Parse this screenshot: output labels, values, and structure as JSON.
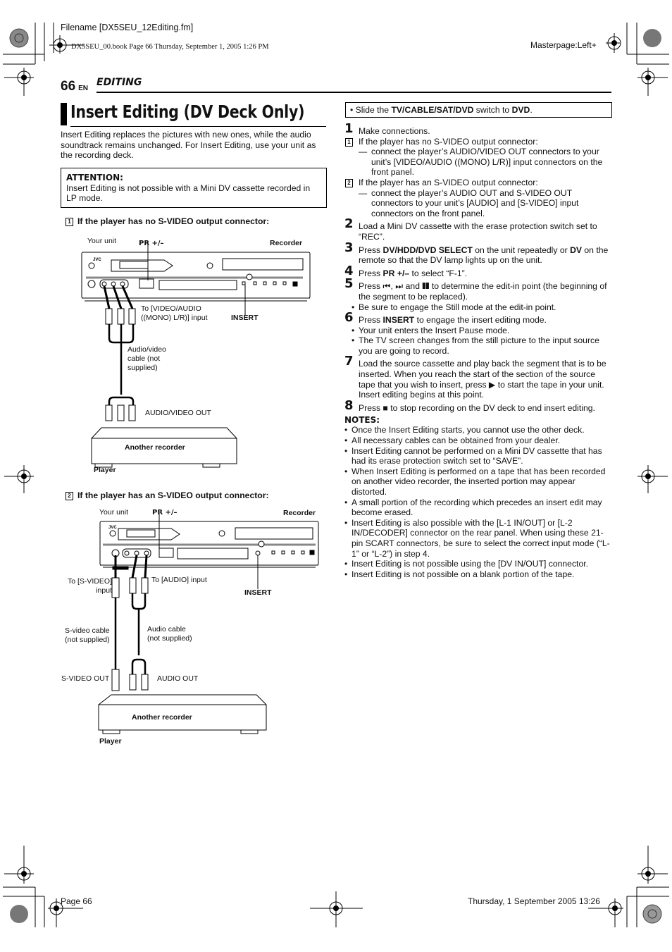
{
  "header": {
    "filename": "Filename [DX5SEU_12Editing.fm]",
    "book_line": "DX5SEU_00.book  Page 66  Thursday, September 1, 2005  1:26 PM",
    "masterpage": "Masterpage:Left+",
    "page_number": "66",
    "lang": "EN",
    "section": "EDITING"
  },
  "title": "Insert Editing (DV Deck Only)",
  "intro": "Insert Editing replaces the pictures with new ones, while the audio soundtrack remains unchanged. For Insert Editing, use your unit as the recording deck.",
  "attention": {
    "heading": "ATTENTION:",
    "text": "Insert Editing is not possible with a Mini DV cassette recorded in LP mode."
  },
  "diagram1": {
    "number": "1",
    "heading": "If the player has no S-VIDEO output connector:",
    "your_unit": "Your unit",
    "pr": "PR +/–",
    "recorder": "Recorder",
    "jvc": "JVC",
    "to_input": "To [VIDEO/AUDIO ((MONO) L/R)] input",
    "insert": "INSERT",
    "cable": "Audio/video cable (not supplied)",
    "out": "AUDIO/VIDEO OUT",
    "another": "Another recorder",
    "player": "Player"
  },
  "diagram2": {
    "number": "2",
    "heading": "If the player has an S-VIDEO output connector:",
    "your_unit": "Your unit",
    "pr": "PR +/–",
    "recorder": "Recorder",
    "jvc": "JVC",
    "to_svideo": "To [S-VIDEO] input",
    "to_audio": "To [AUDIO] input",
    "insert": "INSERT",
    "svideo_cable": "S-video cable (not supplied)",
    "audio_cable": "Audio cable (not supplied)",
    "svideo_out": "S-VIDEO OUT",
    "audio_out": "AUDIO OUT",
    "another": "Another recorder",
    "player": "Player"
  },
  "right": {
    "slide_prefix": "Slide the ",
    "slide_bold1": "TV/CABLE/SAT/DVD",
    "slide_mid": " switch to ",
    "slide_bold2": "DVD",
    "slide_end": ".",
    "steps": [
      {
        "n": "1",
        "text": "Make connections."
      },
      {
        "n": "2",
        "text": "Load a Mini DV cassette with the erase protection switch set to “REC”."
      },
      {
        "n": "3",
        "pre": "Press ",
        "b1": "DV/HDD/DVD SELECT",
        "mid": " on the unit repeatedly or ",
        "b2": "DV",
        "post": " on the remote so that the DV lamp lights up on the unit."
      },
      {
        "n": "4",
        "pre": "Press ",
        "b1": "PR +/–",
        "post": " to select “F-1”."
      },
      {
        "n": "5",
        "text": "Press ⏮, ⏭ and ❚❚ to determine the edit-in point (the beginning of the segment to be replaced).",
        "bullet": "Be sure to engage the Still mode at the edit-in point."
      },
      {
        "n": "6",
        "pre": "Press ",
        "b1": "INSERT",
        "post": " to engage the insert editing mode.",
        "bullets": [
          "Your unit enters the Insert Pause mode.",
          "The TV screen changes from the still picture to the input source you are going to record."
        ]
      },
      {
        "n": "7",
        "text": "Load the source cassette and play back the segment that is to be inserted. When you reach the start of the section of the source tape that you wish to insert, press ▶ to start the tape in your unit. Insert editing begins at this point."
      },
      {
        "n": "8",
        "text": "Press ■ to stop recording on the DV deck to end insert editing."
      }
    ],
    "sub1": {
      "n": "1",
      "label": "If the player has no S-VIDEO output connector:",
      "detail": "connect the player’s AUDIO/VIDEO OUT connectors to your unit’s [VIDEO/AUDIO ((MONO) L/R)] input connectors on the front panel."
    },
    "sub2": {
      "n": "2",
      "label": "If the player has an S-VIDEO output connector:",
      "detail": "connect the player’s AUDIO OUT and S-VIDEO OUT connectors to your unit’s [AUDIO] and [S-VIDEO] input connectors on the front panel."
    },
    "notes_heading": "NOTES:",
    "notes": [
      "Once the Insert Editing starts, you cannot use the other deck.",
      "All necessary cables can be obtained from your dealer.",
      "Insert Editing cannot be performed on a Mini DV cassette that has had its erase protection switch set to “SAVE”.",
      "When Insert Editing is performed on a tape that has been recorded on another video recorder, the inserted portion may appear distorted.",
      "A small portion of the recording which precedes an insert edit may become erased.",
      "Insert Editing is also possible with the [L-1 IN/OUT] or [L-2 IN/DECODER] connector on the rear panel. When using these 21-pin SCART connectors, be sure to select the correct input mode (“L-1” or “L-2”) in step 4.",
      "Insert Editing is not possible using the [DV IN/OUT] connector.",
      "Insert Editing is not possible on a blank portion of the tape."
    ]
  },
  "footer": {
    "page": "Page 66",
    "date": "Thursday, 1 September 2005  13:26"
  }
}
